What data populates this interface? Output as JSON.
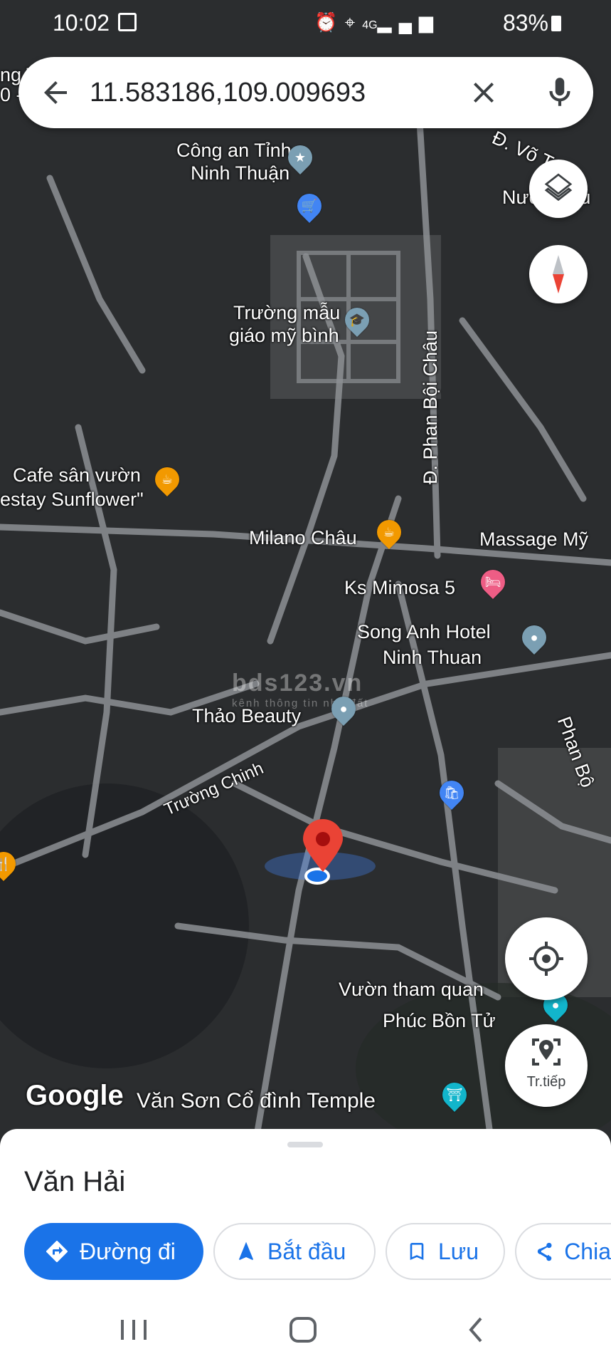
{
  "status_bar": {
    "time": "10:02",
    "signal": "4G",
    "battery": "83%"
  },
  "search": {
    "query": "11.583186,109.009693"
  },
  "map": {
    "watermark": {
      "title": "bds123.vn",
      "subtitle": "kênh thông tin nhà đất"
    },
    "labels": {
      "top_left_partial": "ng T",
      "top_left_partial2": "0 - T",
      "cong_an_1": "Công an Tỉnh",
      "cong_an_2": "Ninh Thuận",
      "vo_tru": "Đ. Võ Trứ",
      "nuoc_phu": "Nước Phú",
      "truong_mau_1": "Trường mẫu",
      "truong_mau_2": "giáo mỹ bình",
      "phan_boi_chau": "Đ. Phan Bội Châu",
      "cafe_1": "Cafe sân vườn",
      "cafe_2": "estay Sunflower\"",
      "milano": "Milano Châu",
      "massage": "Massage Mỹ",
      "mimosa": "Ks Mimosa 5",
      "song_anh_1": "Song Anh Hotel",
      "song_anh_2": "Ninh Thuan",
      "thao_beauty": "Thảo Beauty",
      "truong_chinh": "Trường Chinh",
      "phan_bo": "Phan Bộ",
      "vuon_1": "Vườn tham quan",
      "vuon_2": "Phúc Bồn Tử",
      "temple": "Văn Sơn Cổ đình Temple",
      "google": "Google"
    },
    "buttons": {
      "live_view": "Tr.tiếp"
    }
  },
  "sheet": {
    "place_name": "Văn Hải",
    "actions": [
      {
        "label": "Đường đi"
      },
      {
        "label": "Bắt đầu"
      },
      {
        "label": "Lưu"
      },
      {
        "label": "Chia"
      }
    ]
  },
  "colors": {
    "accent": "#1a73e8",
    "pin": "#ea4335",
    "poi_food": "#f29900",
    "poi_hotel": "#ee5d85",
    "poi_generic": "#7b9fb3",
    "poi_shop": "#4285f4",
    "poi_attraction": "#12b5cb"
  },
  "icons": [
    "back-arrow-icon",
    "close-icon",
    "mic-icon",
    "layers-icon",
    "compass-icon",
    "my-location-icon",
    "live-view-icon",
    "directions-icon",
    "navigation-icon",
    "bookmark-icon",
    "share-icon"
  ]
}
